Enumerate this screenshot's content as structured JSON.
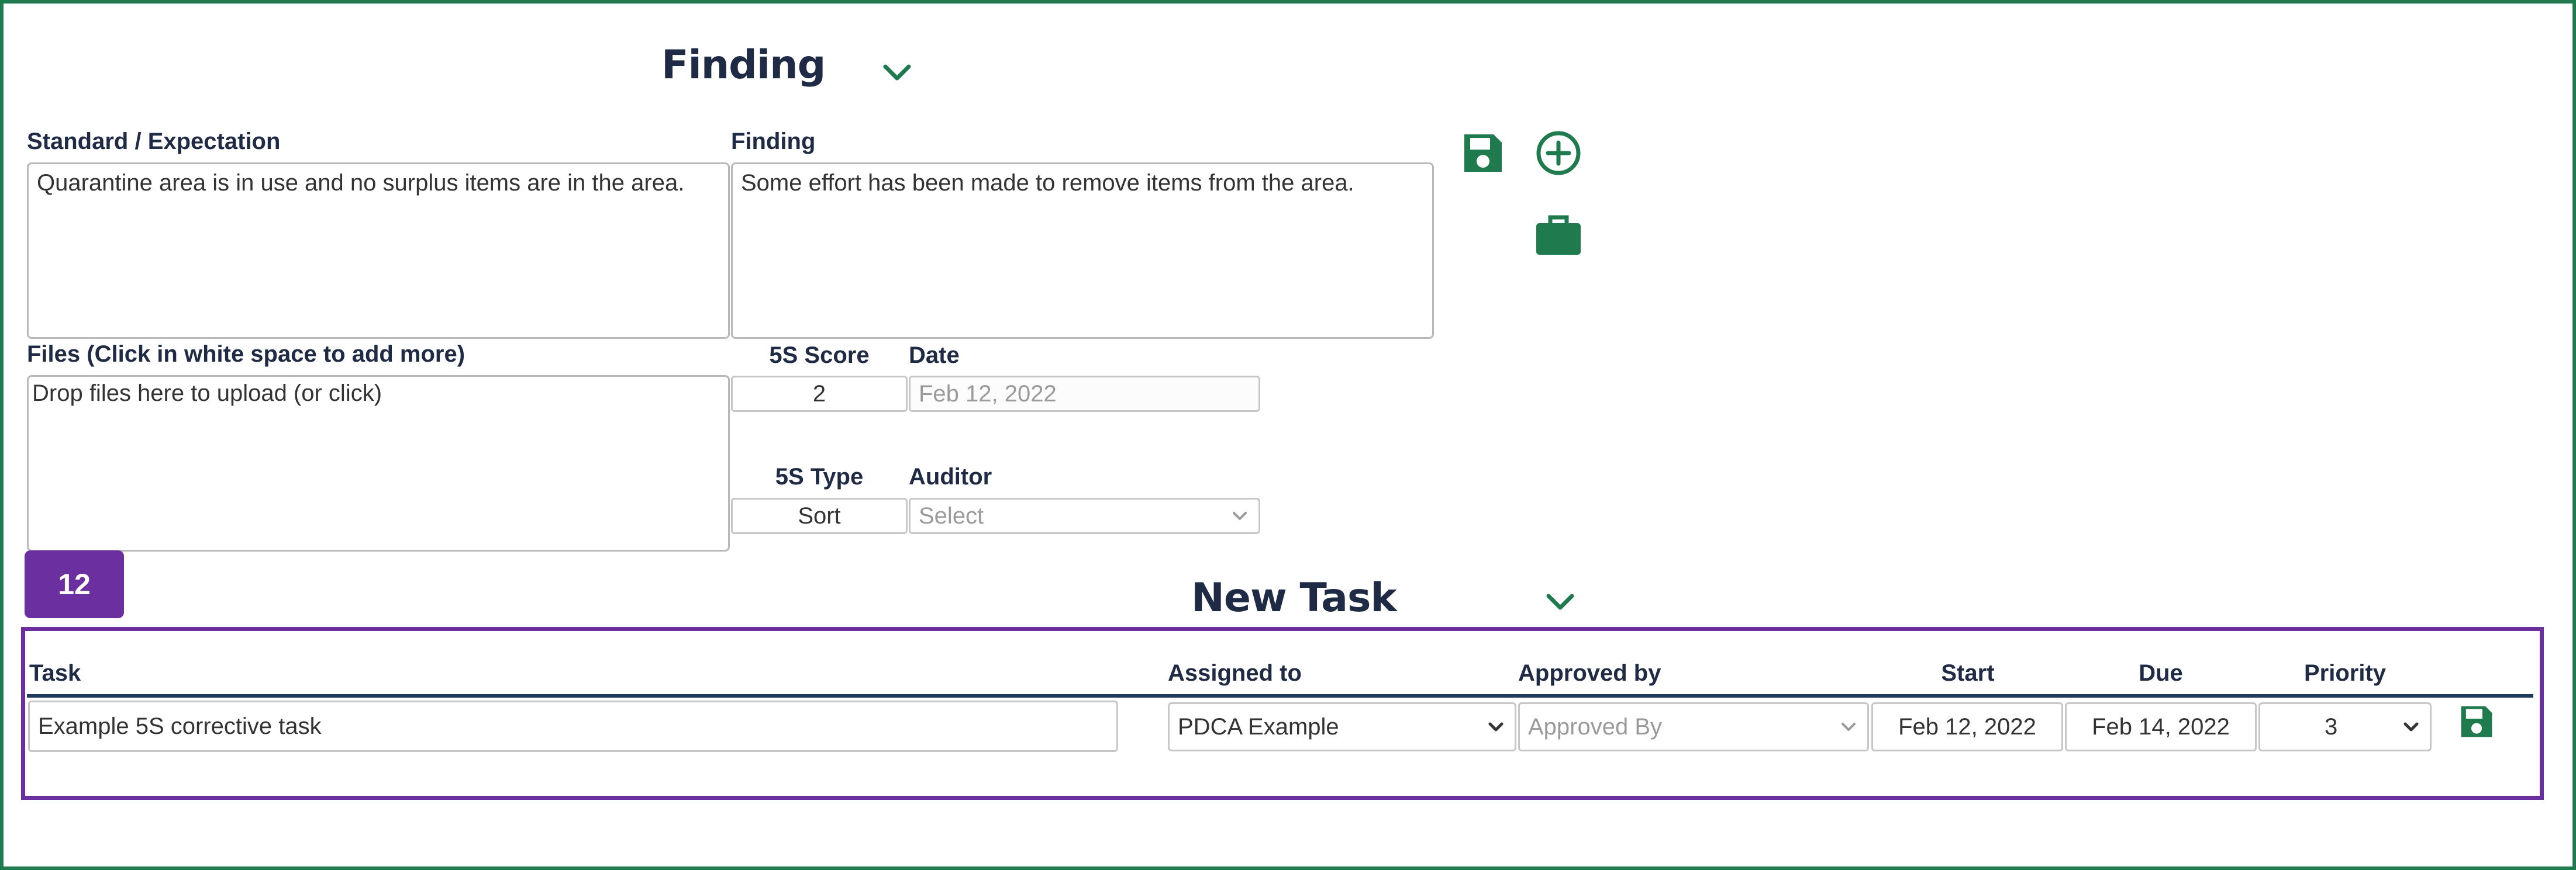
{
  "finding": {
    "heading": "Finding",
    "standard_label": "Standard / Expectation",
    "standard_value": "Quarantine area is in use and no surplus items are in the area.",
    "finding_label": "Finding",
    "finding_value": "Some effort has been made to remove items from the area.",
    "files_label": "Files (Click in white space to add more)",
    "files_placeholder": "Drop files here to upload (or click)",
    "score_label": "5S Score",
    "score_value": "2",
    "date_label": "Date",
    "date_value": "Feb 12, 2022",
    "type_label": "5S Type",
    "type_value": "Sort",
    "auditor_label": "Auditor",
    "auditor_value": "Select"
  },
  "step_badge": "12",
  "new_task": {
    "heading": "New Task",
    "columns": {
      "task": "Task",
      "assigned_to": "Assigned to",
      "approved_by": "Approved by",
      "start": "Start",
      "due": "Due",
      "priority": "Priority"
    },
    "row": {
      "task": "Example 5S corrective task",
      "assigned_to": "PDCA Example",
      "approved_by": "Approved By",
      "start": "Feb 12, 2022",
      "due": "Feb 14, 2022",
      "priority": "3"
    }
  },
  "icons": {
    "save": "floppy-disk-icon",
    "add": "plus-circle-icon",
    "briefcase": "briefcase-icon",
    "chevron": "chevron-down-icon",
    "caret": "select-caret-icon"
  },
  "colors": {
    "frame": "#1f7a4d",
    "accent_green": "#1f7a4d",
    "task_panel": "#6b2fa0",
    "heading_text": "#1f2a44"
  }
}
